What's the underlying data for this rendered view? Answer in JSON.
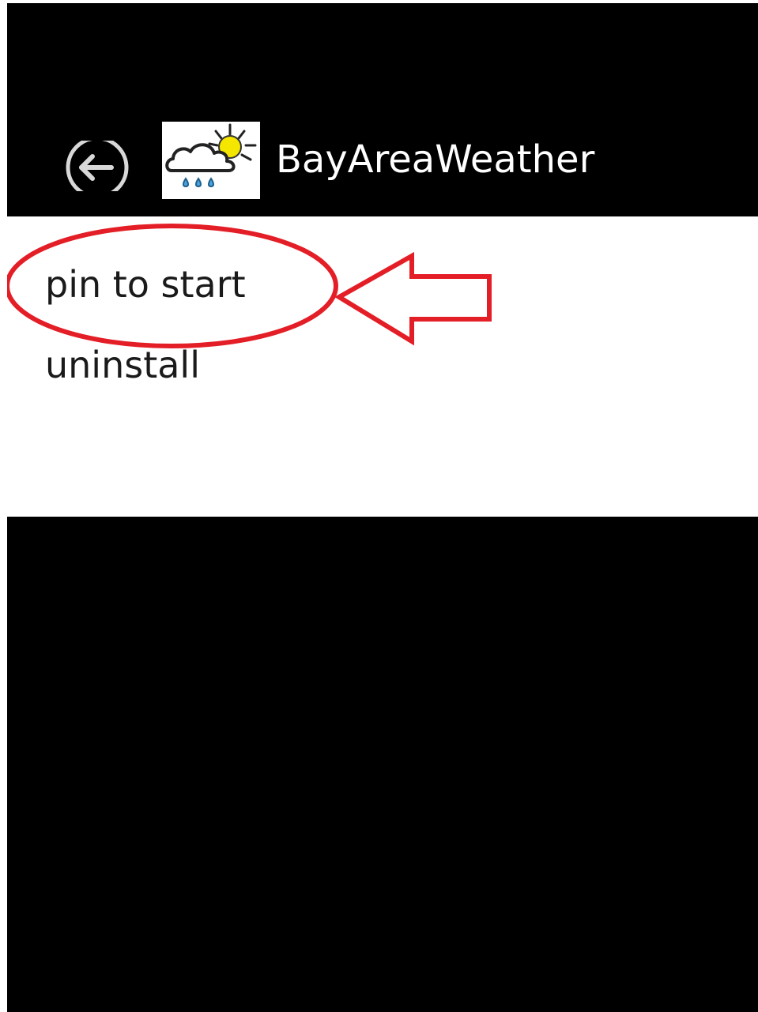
{
  "header": {
    "app_title": "BayAreaWeather",
    "back_icon": "back-arrow-circle-icon",
    "app_icon": "weather-cloud-sun-rain-icon"
  },
  "menu": {
    "items": [
      {
        "label": "pin to start"
      },
      {
        "label": "uninstall"
      }
    ]
  },
  "annotation": {
    "target": "pin to start",
    "color": "#e41e26"
  },
  "colors": {
    "background": "#000000",
    "menu_background": "#ffffff",
    "text_light": "#ffffff",
    "text_dark": "#1a1a1a",
    "sun": "#f5e600",
    "rain": "#4aa3df"
  }
}
